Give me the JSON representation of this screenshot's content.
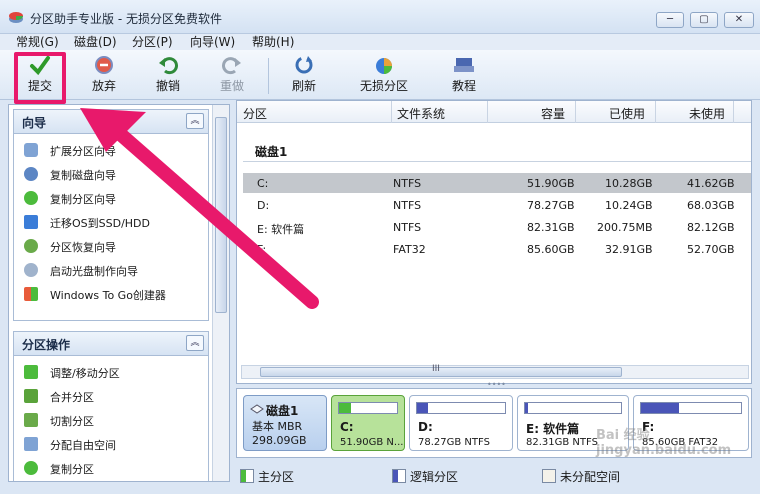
{
  "window": {
    "title": "分区助手专业版 - 无损分区免费软件",
    "minimize": "─",
    "restore": "▢",
    "close": "✕"
  },
  "menu": [
    "常规(G)",
    "磁盘(D)",
    "分区(P)",
    "向导(W)",
    "帮助(H)"
  ],
  "toolbar": {
    "submit": "提交",
    "discard": "放弃",
    "undo": "撤销",
    "redo": "重做",
    "refresh": "刷新",
    "lossless": "无损分区",
    "tutorial": "教程"
  },
  "wizard": {
    "title": "向导",
    "items": [
      "扩展分区向导",
      "复制磁盘向导",
      "复制分区向导",
      "迁移OS到SSD/HDD",
      "分区恢复向导",
      "启动光盘制作向导",
      "Windows To Go创建器"
    ]
  },
  "operations": {
    "title": "分区操作",
    "items": [
      "调整/移动分区",
      "合并分区",
      "切割分区",
      "分配自由空间",
      "复制分区"
    ]
  },
  "table": {
    "columns": [
      "分区",
      "文件系统",
      "容量",
      "已使用",
      "未使用"
    ],
    "disk_label": "磁盘1",
    "rows": [
      {
        "name": "C:",
        "fs": "NTFS",
        "capacity": "51.90GB",
        "used": "10.28GB",
        "free": "41.62GB"
      },
      {
        "name": "D:",
        "fs": "NTFS",
        "capacity": "78.27GB",
        "used": "10.24GB",
        "free": "68.03GB"
      },
      {
        "name": "E: 软件篇",
        "fs": "NTFS",
        "capacity": "82.31GB",
        "used": "200.75MB",
        "free": "82.12GB"
      },
      {
        "name": "F:",
        "fs": "FAT32",
        "capacity": "85.60GB",
        "used": "32.91GB",
        "free": "52.70GB"
      }
    ],
    "scroll_grip": "III"
  },
  "diskmap": {
    "disk_name": "磁盘1",
    "disk_type": "基本 MBR",
    "disk_size": "298.09GB",
    "partitions": [
      {
        "name": "C:",
        "info": "51.90GB N...",
        "used_fraction": 0.2
      },
      {
        "name": "D:",
        "info": "78.27GB NTFS",
        "used_fraction": 0.13
      },
      {
        "name": "E: 软件篇",
        "info": "82.31GB NTFS",
        "used_fraction": 0.03
      },
      {
        "name": "F:",
        "info": "85.60GB FAT32",
        "used_fraction": 0.38
      }
    ]
  },
  "legend": {
    "primary": "主分区",
    "logical": "逻辑分区",
    "unallocated": "未分配空间"
  },
  "watermark": "Bai 经验 jingyan.baidu.com",
  "colors": {
    "highlight": "#e8196b",
    "primary": "#4cbb3c",
    "logical": "#4a55b8"
  }
}
